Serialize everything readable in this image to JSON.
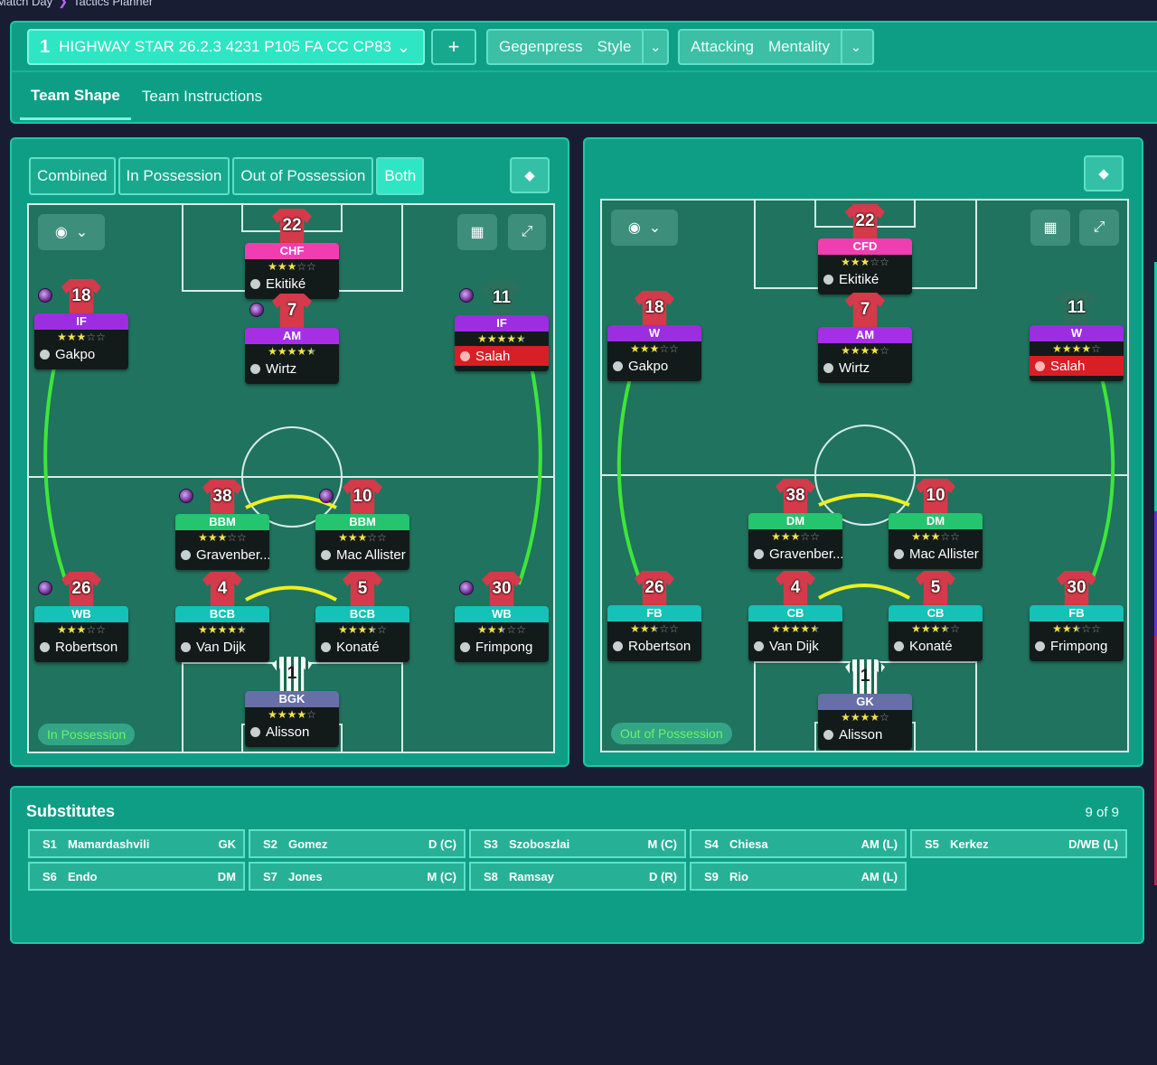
{
  "breadcrumb": {
    "first": "Match Day",
    "second": "Tactics Planner"
  },
  "tactic": {
    "slot": "1",
    "name": "HIGHWAY STAR 26.2.3 4231 P105 FA CC CP83"
  },
  "add_label": "+",
  "style": {
    "value": "Gegenpress",
    "label": "Style"
  },
  "mentality": {
    "value": "Attacking",
    "label": "Mentality"
  },
  "tabs": [
    "Team Shape",
    "Team Instructions"
  ],
  "modes": [
    "Combined",
    "In Possession",
    "Out of Possession",
    "Both"
  ],
  "left_label": "In Possession",
  "right_label": "Out of Possession",
  "in_possession": [
    {
      "id": "gakpo_l",
      "no": "18",
      "role": "IF",
      "cls": "r-if",
      "stars": 3,
      "name": "Gakpo",
      "orb": true
    },
    {
      "id": "ekitike_l",
      "no": "22",
      "role": "CHF",
      "cls": "r-chf",
      "stars": 3,
      "name": "Ekitiké"
    },
    {
      "id": "wirtz_l",
      "no": "7",
      "role": "AM",
      "cls": "r-am",
      "stars": 4.5,
      "name": "Wirtz",
      "orb": true
    },
    {
      "id": "salah_l",
      "no": "11",
      "role": "IF",
      "cls": "r-if",
      "stars": 4.5,
      "name": "Salah",
      "orb": true,
      "injured": true,
      "dim": true
    },
    {
      "id": "grav_l",
      "no": "38",
      "role": "BBM",
      "cls": "r-bbm",
      "stars": 3,
      "name": "Gravenber...",
      "orb": true
    },
    {
      "id": "macal_l",
      "no": "10",
      "role": "BBM",
      "cls": "r-bbm",
      "stars": 3,
      "name": "Mac Allister",
      "orb": true
    },
    {
      "id": "robbo_l",
      "no": "26",
      "role": "WB",
      "cls": "r-wb",
      "stars": 3,
      "name": "Robertson",
      "orb": true
    },
    {
      "id": "vvd_l",
      "no": "4",
      "role": "BCB",
      "cls": "r-bcb",
      "stars": 4.5,
      "name": "Van Dijk"
    },
    {
      "id": "konate_l",
      "no": "5",
      "role": "BCB",
      "cls": "r-bcb",
      "stars": 3.5,
      "name": "Konaté"
    },
    {
      "id": "frim_l",
      "no": "30",
      "role": "WB",
      "cls": "r-wb",
      "stars": 2.5,
      "name": "Frimpong",
      "orb": true
    },
    {
      "id": "alisson_l",
      "no": "1",
      "role": "BGK",
      "cls": "r-bgk",
      "stars": 4,
      "name": "Alisson",
      "gk": true
    }
  ],
  "out_possession": [
    {
      "id": "gakpo_r",
      "no": "18",
      "role": "W",
      "cls": "r-w",
      "stars": 3,
      "name": "Gakpo"
    },
    {
      "id": "ekitike_r",
      "no": "22",
      "role": "CFD",
      "cls": "r-chf",
      "stars": 3,
      "name": "Ekitiké"
    },
    {
      "id": "wirtz_r",
      "no": "7",
      "role": "AM",
      "cls": "r-am",
      "stars": 4,
      "name": "Wirtz"
    },
    {
      "id": "salah_r",
      "no": "11",
      "role": "W",
      "cls": "r-w",
      "stars": 4,
      "name": "Salah",
      "injured": true,
      "dim": true
    },
    {
      "id": "grav_r",
      "no": "38",
      "role": "DM",
      "cls": "r-dm",
      "stars": 3,
      "name": "Gravenber..."
    },
    {
      "id": "macal_r",
      "no": "10",
      "role": "DM",
      "cls": "r-dm",
      "stars": 3,
      "name": "Mac Allister"
    },
    {
      "id": "robbo_r",
      "no": "26",
      "role": "FB",
      "cls": "r-fb",
      "stars": 2.5,
      "name": "Robertson"
    },
    {
      "id": "vvd_r",
      "no": "4",
      "role": "CB",
      "cls": "r-cb",
      "stars": 4.5,
      "name": "Van Dijk"
    },
    {
      "id": "konate_r",
      "no": "5",
      "role": "CB",
      "cls": "r-cb",
      "stars": 3.5,
      "name": "Konaté"
    },
    {
      "id": "frim_r",
      "no": "30",
      "role": "FB",
      "cls": "r-fb",
      "stars": 2.5,
      "name": "Frimpong"
    },
    {
      "id": "alisson_r",
      "no": "1",
      "role": "GK",
      "cls": "r-bgk",
      "stars": 4,
      "name": "Alisson",
      "gk": true
    }
  ],
  "substitutes": {
    "title": "Substitutes",
    "count": "9 of 9",
    "items": [
      {
        "slot": "S1",
        "name": "Mamardashvili",
        "pos": "GK"
      },
      {
        "slot": "S2",
        "name": "Gomez",
        "pos": "D (C)"
      },
      {
        "slot": "S3",
        "name": "Szoboszlai",
        "pos": "M (C)"
      },
      {
        "slot": "S4",
        "name": "Chiesa",
        "pos": "AM (L)"
      },
      {
        "slot": "S5",
        "name": "Kerkez",
        "pos": "D/WB (L)"
      },
      {
        "slot": "S6",
        "name": "Endo",
        "pos": "DM"
      },
      {
        "slot": "S7",
        "name": "Jones",
        "pos": "M (C)"
      },
      {
        "slot": "S8",
        "name": "Ramsay",
        "pos": "D (R)"
      },
      {
        "slot": "S9",
        "name": "Rio",
        "pos": "AM (L)"
      }
    ]
  },
  "colors": {
    "panel": "#0e9e86",
    "pitch": "#20735e",
    "accent": "#2ee6c4",
    "link_green": "#3ee63a",
    "link_yellow": "#ecf021"
  }
}
